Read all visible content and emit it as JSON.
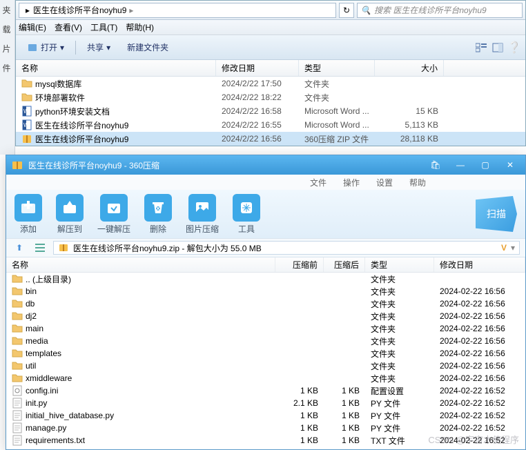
{
  "explorer": {
    "breadcrumb": "医生在线诊所平台noyhu9",
    "search_placeholder": "搜索 医生在线诊所平台noyhu9",
    "menus": {
      "edit": "编辑(E)",
      "view": "查看(V)",
      "tools": "工具(T)",
      "help": "帮助(H)"
    },
    "toolbar": {
      "open": "打开",
      "share": "共享",
      "newfolder": "新建文件夹"
    },
    "headers": {
      "name": "名称",
      "date": "修改日期",
      "type": "类型",
      "size": "大小"
    },
    "files": [
      {
        "name": "mysql数据库",
        "date": "2024/2/22 17:50",
        "type": "文件夹",
        "size": "",
        "icon": "folder"
      },
      {
        "name": "环境部署软件",
        "date": "2024/2/22 18:22",
        "type": "文件夹",
        "size": "",
        "icon": "folder"
      },
      {
        "name": "python环境安装文档",
        "date": "2024/2/22 16:58",
        "type": "Microsoft Word ...",
        "size": "15 KB",
        "icon": "word"
      },
      {
        "name": "医生在线诊所平台noyhu9",
        "date": "2024/2/22 16:55",
        "type": "Microsoft Word ...",
        "size": "5,113 KB",
        "icon": "word"
      },
      {
        "name": "医生在线诊所平台noyhu9",
        "date": "2024/2/22 16:56",
        "type": "360压缩 ZIP 文件",
        "size": "28,118 KB",
        "icon": "zip",
        "selected": true
      }
    ]
  },
  "archive": {
    "title": "医生在线诊所平台noyhu9 - 360压缩",
    "menu": {
      "file": "文件",
      "op": "操作",
      "settings": "设置",
      "help": "帮助"
    },
    "tools": {
      "add": "添加",
      "extract": "解压到",
      "oneclick": "一键解压",
      "delete": "删除",
      "imgcompress": "图片压缩",
      "tool": "工具",
      "scan": "扫描"
    },
    "pathbar": "医生在线诊所平台noyhu9.zip - 解包大小为 55.0 MB",
    "pathbar_v": "V",
    "headers": {
      "name": "名称",
      "before": "压缩前",
      "after": "压缩后",
      "type": "类型",
      "date": "修改日期"
    },
    "files": [
      {
        "name": ".. (上级目录)",
        "before": "",
        "after": "",
        "type": "文件夹",
        "date": "",
        "icon": "folder-up"
      },
      {
        "name": "bin",
        "before": "",
        "after": "",
        "type": "文件夹",
        "date": "2024-02-22 16:56",
        "icon": "folder"
      },
      {
        "name": "db",
        "before": "",
        "after": "",
        "type": "文件夹",
        "date": "2024-02-22 16:56",
        "icon": "folder"
      },
      {
        "name": "dj2",
        "before": "",
        "after": "",
        "type": "文件夹",
        "date": "2024-02-22 16:56",
        "icon": "folder"
      },
      {
        "name": "main",
        "before": "",
        "after": "",
        "type": "文件夹",
        "date": "2024-02-22 16:56",
        "icon": "folder"
      },
      {
        "name": "media",
        "before": "",
        "after": "",
        "type": "文件夹",
        "date": "2024-02-22 16:56",
        "icon": "folder"
      },
      {
        "name": "templates",
        "before": "",
        "after": "",
        "type": "文件夹",
        "date": "2024-02-22 16:56",
        "icon": "folder"
      },
      {
        "name": "util",
        "before": "",
        "after": "",
        "type": "文件夹",
        "date": "2024-02-22 16:56",
        "icon": "folder"
      },
      {
        "name": "xmiddleware",
        "before": "",
        "after": "",
        "type": "文件夹",
        "date": "2024-02-22 16:56",
        "icon": "folder"
      },
      {
        "name": "config.ini",
        "before": "1 KB",
        "after": "1 KB",
        "type": "配置设置",
        "date": "2024-02-22 16:52",
        "icon": "ini"
      },
      {
        "name": "init.py",
        "before": "2.1 KB",
        "after": "1 KB",
        "type": "PY 文件",
        "date": "2024-02-22 16:52",
        "icon": "py"
      },
      {
        "name": "initial_hive_database.py",
        "before": "1 KB",
        "after": "1 KB",
        "type": "PY 文件",
        "date": "2024-02-22 16:52",
        "icon": "py"
      },
      {
        "name": "manage.py",
        "before": "1 KB",
        "after": "1 KB",
        "type": "PY 文件",
        "date": "2024-02-22 16:52",
        "icon": "py"
      },
      {
        "name": "requirements.txt",
        "before": "1 KB",
        "after": "1 KB",
        "type": "TXT 文件",
        "date": "2024-02-22 16:52",
        "icon": "txt"
      }
    ]
  },
  "gutter": [
    "夹",
    "载",
    "片",
    "件"
  ],
  "watermark": "CSDN @宇宙木使程序"
}
